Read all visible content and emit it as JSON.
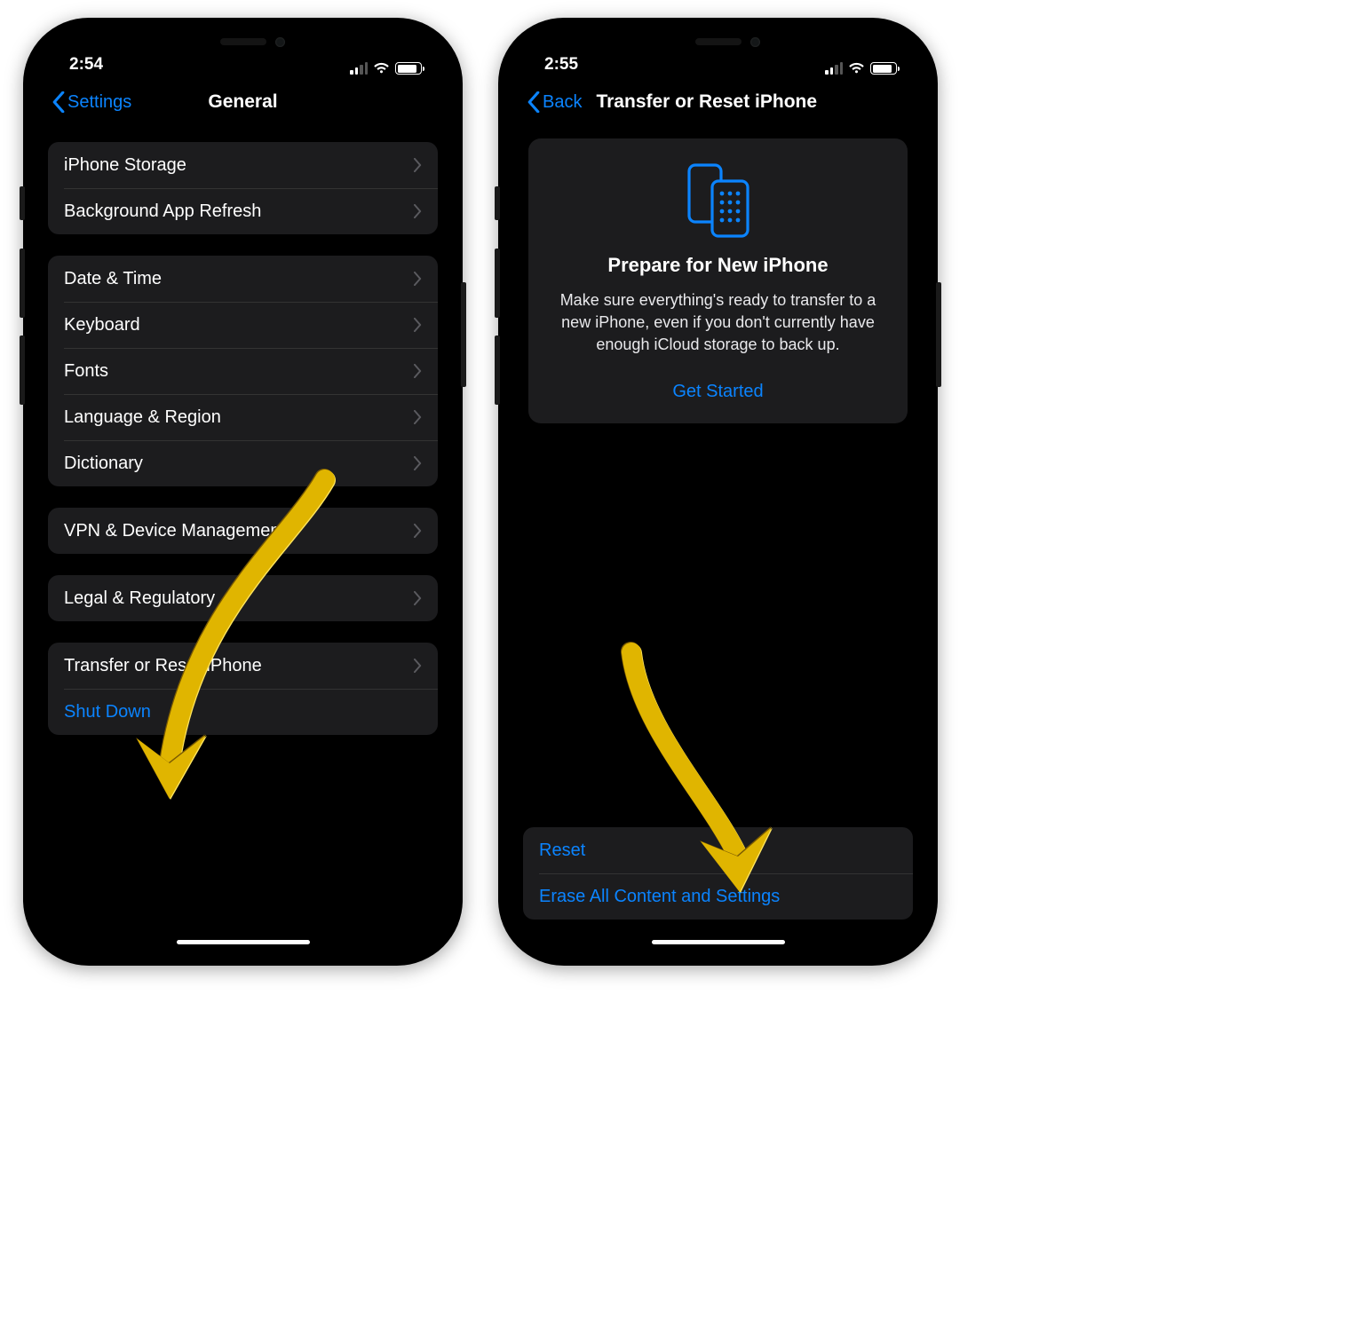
{
  "leftPhone": {
    "status": {
      "time": "2:54"
    },
    "nav": {
      "back": "Settings",
      "title": "General"
    },
    "groups": [
      {
        "rows": [
          {
            "label": "iPhone Storage",
            "chevron": true
          },
          {
            "label": "Background App Refresh",
            "chevron": true
          }
        ]
      },
      {
        "rows": [
          {
            "label": "Date & Time",
            "chevron": true
          },
          {
            "label": "Keyboard",
            "chevron": true
          },
          {
            "label": "Fonts",
            "chevron": true
          },
          {
            "label": "Language & Region",
            "chevron": true
          },
          {
            "label": "Dictionary",
            "chevron": true
          }
        ]
      },
      {
        "rows": [
          {
            "label": "VPN & Device Management",
            "chevron": true
          }
        ]
      },
      {
        "rows": [
          {
            "label": "Legal & Regulatory",
            "chevron": true
          }
        ]
      },
      {
        "rows": [
          {
            "label": "Transfer or Reset iPhone",
            "chevron": true
          },
          {
            "label": "Shut Down",
            "chevron": false,
            "blue": true
          }
        ]
      }
    ]
  },
  "rightPhone": {
    "status": {
      "time": "2:55"
    },
    "nav": {
      "back": "Back",
      "title": "Transfer or Reset iPhone"
    },
    "panel": {
      "heading": "Prepare for New iPhone",
      "body": "Make sure everything's ready to transfer to a new iPhone, even if you don't currently have enough iCloud storage to back up.",
      "cta": "Get Started"
    },
    "bottomGroup": {
      "rows": [
        {
          "label": "Reset",
          "blue": true
        },
        {
          "label": "Erase All Content and Settings",
          "blue": true
        }
      ]
    }
  },
  "colors": {
    "accent": "#0b84ff",
    "annotation": "#e0b500"
  }
}
